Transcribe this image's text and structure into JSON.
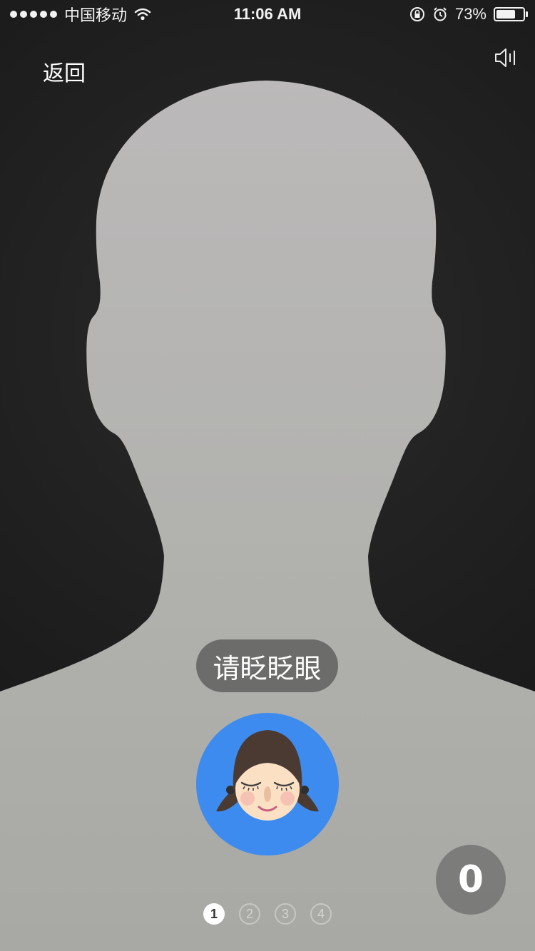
{
  "status_bar": {
    "carrier": "中国移动",
    "time": "11:06 AM",
    "battery_percent": "73%",
    "battery_level": 0.73,
    "signal_bars": 5,
    "icons": [
      "wifi-icon",
      "orientation-lock-icon",
      "alarm-icon",
      "battery-icon"
    ]
  },
  "header": {
    "back_label": "返回",
    "sound_icon": "speaker-icon"
  },
  "prompt": {
    "text": "请眨眨眼"
  },
  "action_icon": "blinking-girl-face-icon",
  "counter": {
    "value": "0"
  },
  "steps": [
    {
      "label": "1",
      "active": true
    },
    {
      "label": "2",
      "active": false
    },
    {
      "label": "3",
      "active": false
    },
    {
      "label": "4",
      "active": false
    }
  ],
  "colors": {
    "accent_blue": "#3d8bef",
    "silhouette_gray": "#b4b4b2",
    "background_dark": "#1f1f1f"
  }
}
